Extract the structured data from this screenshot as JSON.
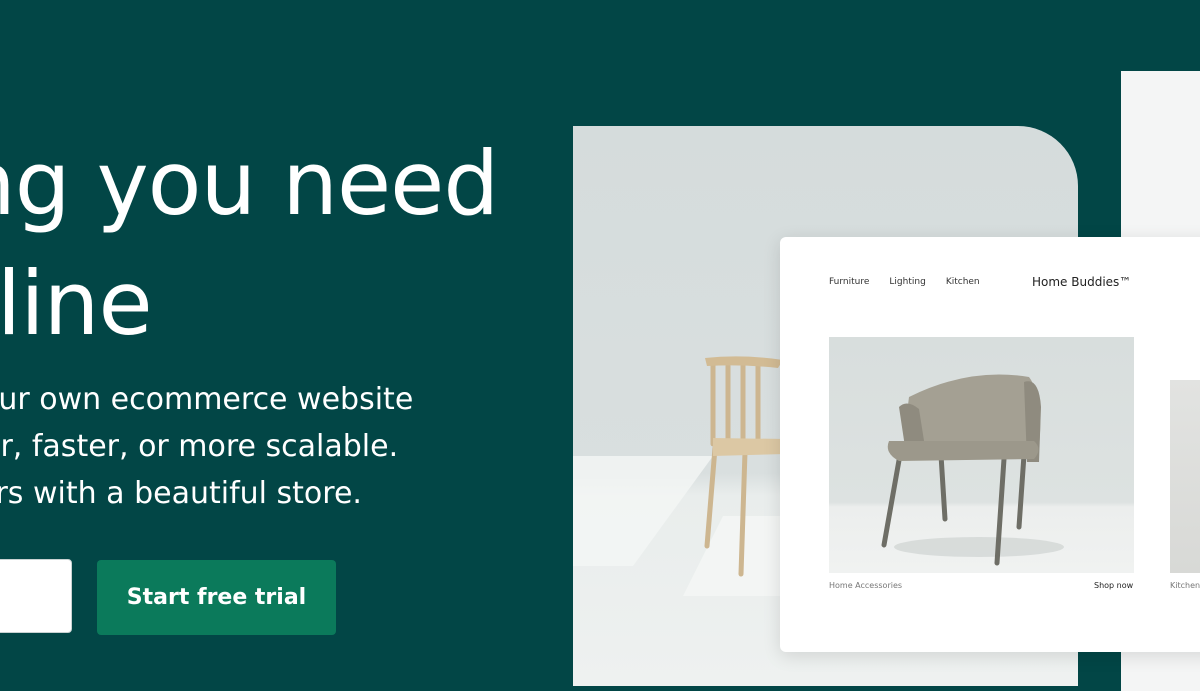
{
  "hero": {
    "headline_line1": "ng you need",
    "headline_line2": "nline",
    "subtext_line1": "our own ecommerce website",
    "subtext_line2": "er, faster, or more scalable.",
    "subtext_line3": "ners with a beautiful store.",
    "email_value": "",
    "cta_label": "Start free trial"
  },
  "store_preview": {
    "nav": [
      "Furniture",
      "Lighting",
      "Kitchen"
    ],
    "brand": "Home Buddies™",
    "product_label": "Home Accessories",
    "product_link": "Shop now",
    "second_label": "Kitchen"
  },
  "colors": {
    "background": "#024646",
    "cta": "#0b7a5b",
    "text": "#ffffff"
  }
}
